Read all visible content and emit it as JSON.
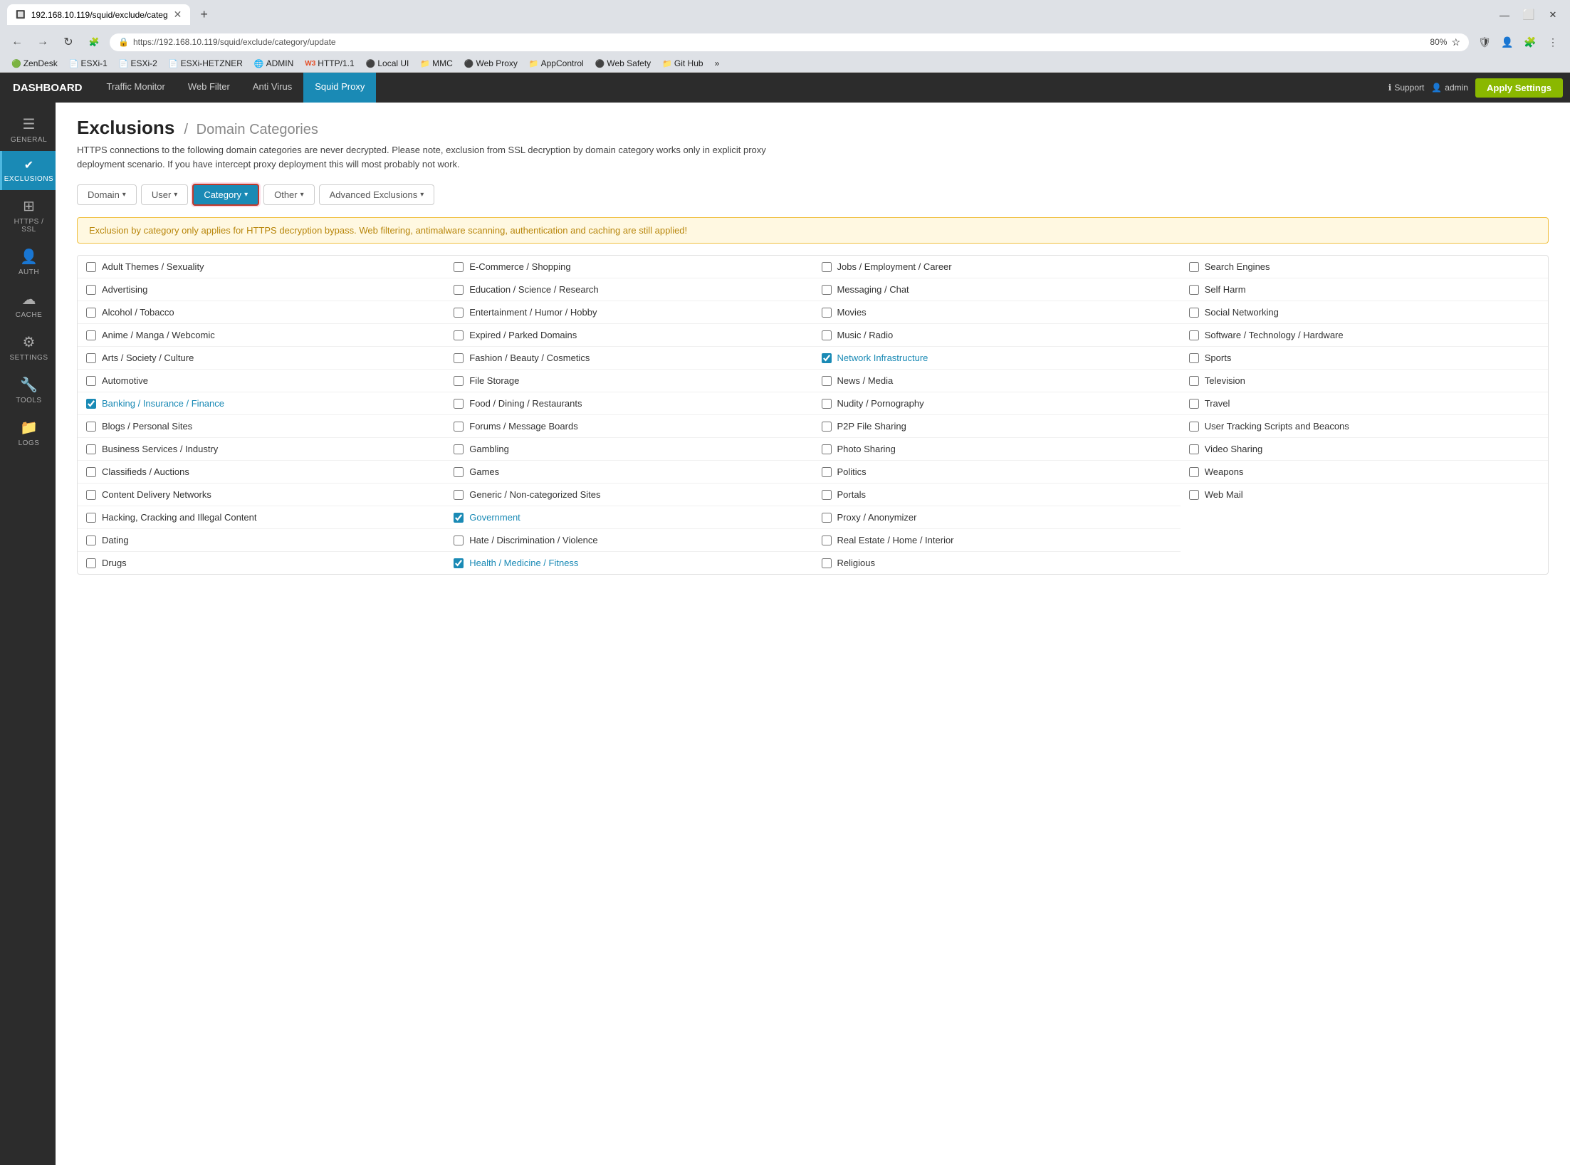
{
  "browser": {
    "tab_title": "192.168.10.119/squid/exclude/categ",
    "url": "https://192.168.10.119/squid/exclude/category/update",
    "zoom": "80%",
    "bookmarks": [
      {
        "icon": "🟢",
        "label": "ZenDesk"
      },
      {
        "icon": "📄",
        "label": "ESXi-1"
      },
      {
        "icon": "📄",
        "label": "ESXi-2"
      },
      {
        "icon": "📄",
        "label": "ESXi-HETZNER"
      },
      {
        "icon": "🌐",
        "label": "ADMIN"
      },
      {
        "icon": "W3",
        "label": "HTTP/1.1"
      },
      {
        "icon": "⚫",
        "label": "Local UI"
      },
      {
        "icon": "📁",
        "label": "MMC"
      },
      {
        "icon": "⚫",
        "label": "Web Proxy"
      },
      {
        "icon": "📁",
        "label": "AppControl"
      },
      {
        "icon": "⚫",
        "label": "Web Safety"
      },
      {
        "icon": "📁",
        "label": "Git Hub"
      },
      {
        "icon": "»",
        "label": ""
      }
    ]
  },
  "app": {
    "brand": "DASHBOARD",
    "nav": [
      {
        "label": "Traffic Monitor",
        "active": false
      },
      {
        "label": "Web Filter",
        "active": false
      },
      {
        "label": "Anti Virus",
        "active": false
      },
      {
        "label": "Squid Proxy",
        "active": true
      }
    ],
    "support_label": "Support",
    "admin_label": "admin",
    "apply_btn": "Apply Settings"
  },
  "sidebar": [
    {
      "label": "GENERAL",
      "icon": "☰",
      "active": false
    },
    {
      "label": "EXCLUSIONS",
      "icon": "✓",
      "active": true
    },
    {
      "label": "HTTPS / SSL",
      "icon": "⊞",
      "active": false
    },
    {
      "label": "AUTH",
      "icon": "👤",
      "active": false
    },
    {
      "label": "CACHE",
      "icon": "☁",
      "active": false
    },
    {
      "label": "SETTINGS",
      "icon": "⚙",
      "active": false
    },
    {
      "label": "TOOLS",
      "icon": "🔧",
      "active": false
    },
    {
      "label": "LOGS",
      "icon": "📁",
      "active": false
    }
  ],
  "page": {
    "title": "Exclusions",
    "breadcrumb": "Domain Categories",
    "description": "HTTPS connections to the following domain categories are never decrypted. Please note, exclusion from SSL decryption by domain category works only in explicit proxy deployment scenario. If you have intercept proxy deployment this will most probably not work."
  },
  "tabs": [
    {
      "label": "Domain",
      "active": false
    },
    {
      "label": "User",
      "active": false
    },
    {
      "label": "Category",
      "active": true
    },
    {
      "label": "Other",
      "active": false
    },
    {
      "label": "Advanced Exclusions",
      "active": false
    }
  ],
  "info_banner": "Exclusion by category only applies for HTTPS decryption bypass. Web filtering, antimalware scanning, authentication and caching are still applied!",
  "categories": {
    "col1": [
      {
        "label": "Adult Themes / Sexuality",
        "checked": false
      },
      {
        "label": "Advertising",
        "checked": false
      },
      {
        "label": "Alcohol / Tobacco",
        "checked": false
      },
      {
        "label": "Anime / Manga / Webcomic",
        "checked": false
      },
      {
        "label": "Arts / Society / Culture",
        "checked": false
      },
      {
        "label": "Automotive",
        "checked": false
      },
      {
        "label": "Banking / Insurance / Finance",
        "checked": true
      },
      {
        "label": "Blogs / Personal Sites",
        "checked": false
      },
      {
        "label": "Business Services / Industry",
        "checked": false
      },
      {
        "label": "Classifieds / Auctions",
        "checked": false
      },
      {
        "label": "Content Delivery Networks",
        "checked": false
      },
      {
        "label": "Hacking, Cracking and Illegal Content",
        "checked": false
      },
      {
        "label": "Dating",
        "checked": false
      },
      {
        "label": "Drugs",
        "checked": false
      }
    ],
    "col2": [
      {
        "label": "E-Commerce / Shopping",
        "checked": false
      },
      {
        "label": "Education / Science / Research",
        "checked": false
      },
      {
        "label": "Entertainment / Humor / Hobby",
        "checked": false
      },
      {
        "label": "Expired / Parked Domains",
        "checked": false
      },
      {
        "label": "Fashion / Beauty / Cosmetics",
        "checked": false
      },
      {
        "label": "File Storage",
        "checked": false
      },
      {
        "label": "Food / Dining / Restaurants",
        "checked": false
      },
      {
        "label": "Forums / Message Boards",
        "checked": false
      },
      {
        "label": "Gambling",
        "checked": false
      },
      {
        "label": "Games",
        "checked": false
      },
      {
        "label": "Generic / Non-categorized Sites",
        "checked": false
      },
      {
        "label": "Government",
        "checked": true
      },
      {
        "label": "Hate / Discrimination / Violence",
        "checked": false
      },
      {
        "label": "Health / Medicine / Fitness",
        "checked": true
      }
    ],
    "col3": [
      {
        "label": "Jobs / Employment / Career",
        "checked": false
      },
      {
        "label": "Messaging / Chat",
        "checked": false
      },
      {
        "label": "Movies",
        "checked": false
      },
      {
        "label": "Music / Radio",
        "checked": false
      },
      {
        "label": "Network Infrastructure",
        "checked": true
      },
      {
        "label": "News / Media",
        "checked": false
      },
      {
        "label": "Nudity / Pornography",
        "checked": false
      },
      {
        "label": "P2P File Sharing",
        "checked": false
      },
      {
        "label": "Photo Sharing",
        "checked": false
      },
      {
        "label": "Politics",
        "checked": false
      },
      {
        "label": "Portals",
        "checked": false
      },
      {
        "label": "Proxy / Anonymizer",
        "checked": false
      },
      {
        "label": "Real Estate / Home / Interior",
        "checked": false
      },
      {
        "label": "Religious",
        "checked": false
      }
    ],
    "col4": [
      {
        "label": "Search Engines",
        "checked": false
      },
      {
        "label": "Self Harm",
        "checked": false
      },
      {
        "label": "Social Networking",
        "checked": false
      },
      {
        "label": "Software / Technology / Hardware",
        "checked": false
      },
      {
        "label": "Sports",
        "checked": false
      },
      {
        "label": "Television",
        "checked": false
      },
      {
        "label": "Travel",
        "checked": false
      },
      {
        "label": "User Tracking Scripts and Beacons",
        "checked": false
      },
      {
        "label": "Video Sharing",
        "checked": false
      },
      {
        "label": "Weapons",
        "checked": false
      },
      {
        "label": "Web Mail",
        "checked": false
      }
    ]
  }
}
